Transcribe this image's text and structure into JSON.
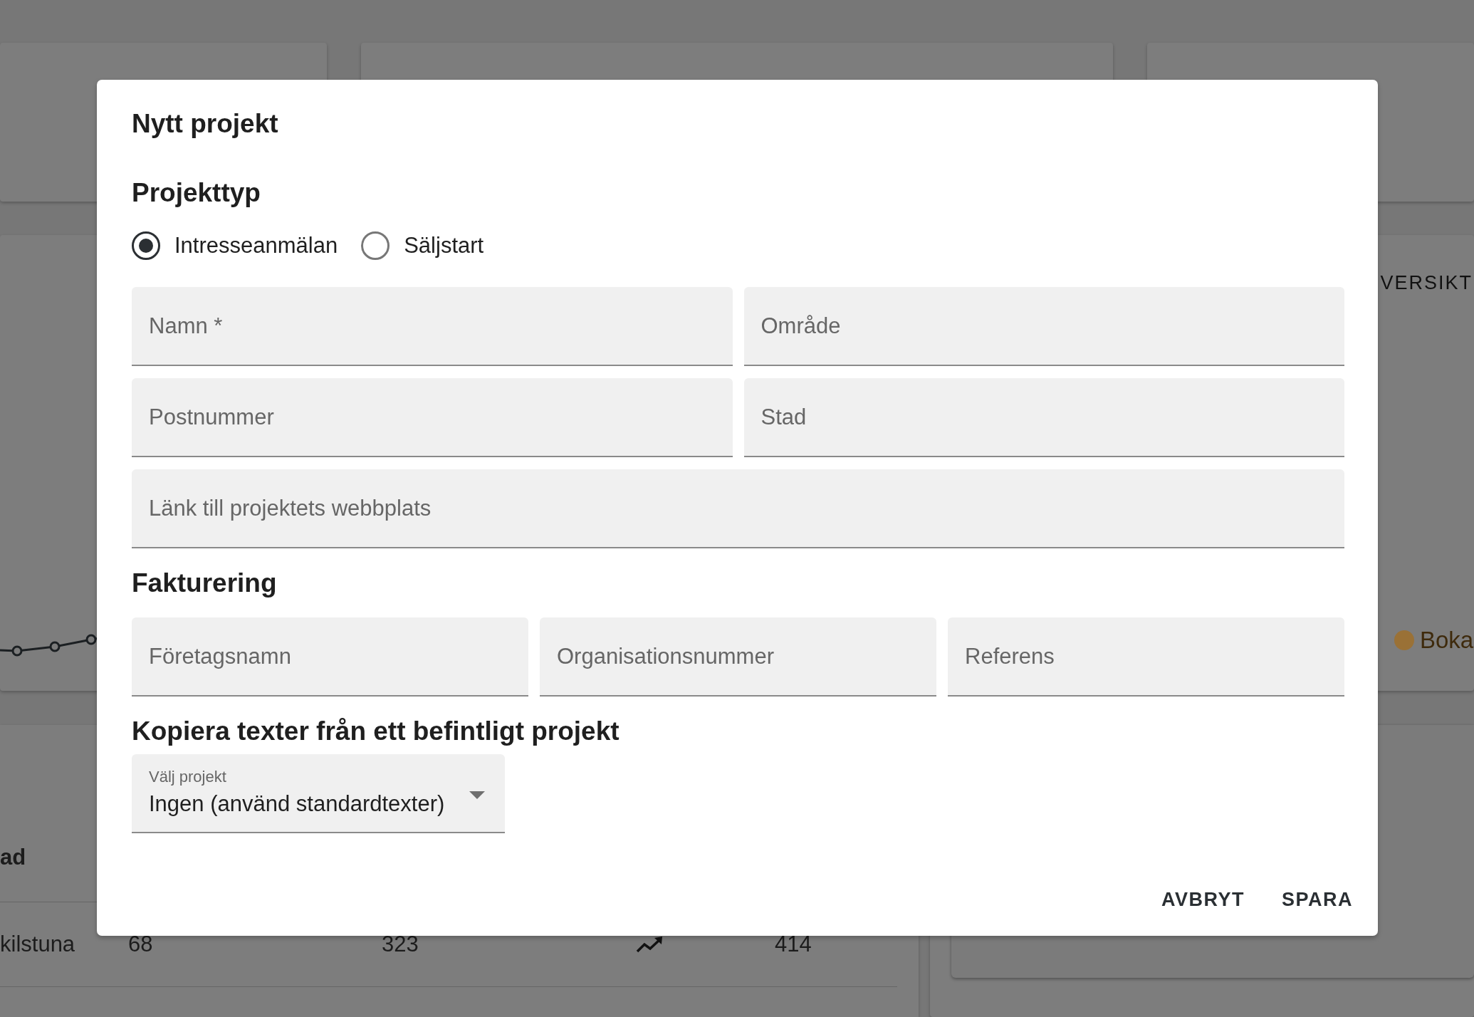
{
  "dashboard": {
    "overview_title": "VERSIKT",
    "legend": [
      {
        "label": "Boka",
        "color": "#9a7136"
      }
    ],
    "table": {
      "heading": "ad",
      "rows": [
        {
          "cells": [
            "kilstuna",
            "68",
            "323",
            "414"
          ]
        }
      ]
    }
  },
  "dialog": {
    "title": "Nytt projekt",
    "sections": [
      {
        "heading": "Projekttyp",
        "radios": [
          {
            "label": "Intresseanmälan",
            "selected": true
          },
          {
            "label": "Säljstart",
            "selected": false
          }
        ],
        "field_rows": [
          [
            {
              "placeholder": "Namn *"
            },
            {
              "placeholder": "Område"
            }
          ],
          [
            {
              "placeholder": "Postnummer"
            },
            {
              "placeholder": "Stad"
            }
          ],
          [
            {
              "placeholder": "Länk till projektets webbplats"
            }
          ]
        ]
      },
      {
        "heading": "Fakturering",
        "field_rows": [
          [
            {
              "placeholder": "Företagsnamn"
            },
            {
              "placeholder": "Organisationsnummer"
            },
            {
              "placeholder": "Referens"
            }
          ]
        ]
      },
      {
        "heading": "Kopiera texter från ett befintligt projekt",
        "select": {
          "label": "Välj projekt",
          "value": "Ingen (använd standardtexter)"
        }
      }
    ],
    "buttons": [
      "AVBRYT",
      "SPARA"
    ]
  }
}
